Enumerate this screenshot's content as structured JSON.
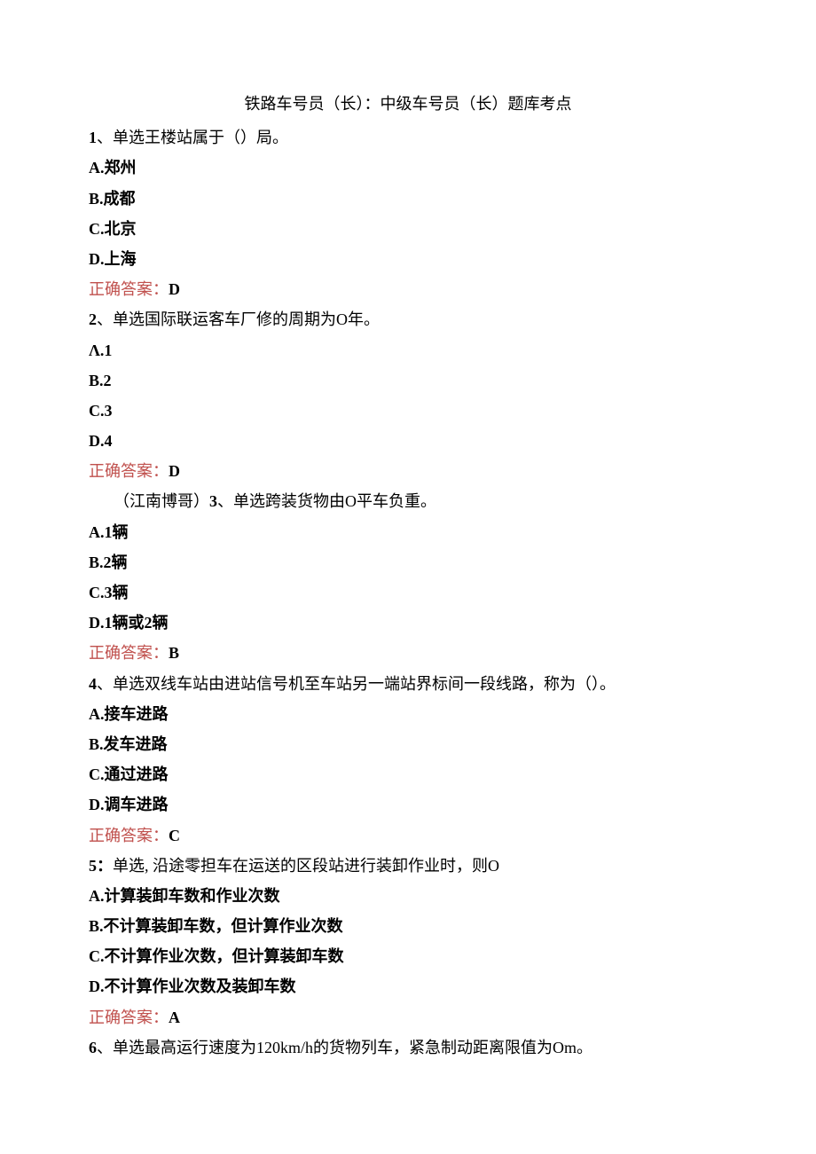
{
  "title": "铁路车号员（长）：中级车号员（长）题库考点",
  "q1": {
    "prefix": "1",
    "stem": "、单选王楼站属于（）局。",
    "A": "A.郑州",
    "B": "B.成都",
    "C": "C.北京",
    "D": "D.上海",
    "ans_label": "正确答案：",
    "ans_value": "D"
  },
  "q2": {
    "prefix": "2",
    "stem": "、单选国际联运客车厂修的周期为O年。",
    "A": "Λ.1",
    "B": "B.2",
    "C": "C.3",
    "D": "D.4",
    "ans_label": "正确答案：",
    "ans_value": "D"
  },
  "q3": {
    "inline_prefix": "（江南博哥）",
    "prefix": "3",
    "stem": "、单选跨装货物由O平车负重。",
    "A": "A.1辆",
    "B": "B.2辆",
    "C": "C.3辆",
    "D": "D.1辆或2辆",
    "ans_label": "正确答案：",
    "ans_value": "B"
  },
  "q4": {
    "prefix": "4",
    "stem": "、单选双线车站由进站信号机至车站另一端站界标间一段线路，称为（）。",
    "A": "A.接车进路",
    "B": "B.发车进路",
    "C": "C.通过进路",
    "D": "D.调车进路",
    "ans_label": "正确答案：",
    "ans_value": "C"
  },
  "q5": {
    "prefix": "5：",
    "stem": "单选, 沿途零担车在运送的区段站进行装卸作业时，则O",
    "A": "A.计算装卸车数和作业次数",
    "B": "B.不计算装卸车数，但计算作业次数",
    "C": "C.不计算作业次数，但计算装卸车数",
    "D": "D.不计算作业次数及装卸车数",
    "ans_label": "正确答案：",
    "ans_value": "A"
  },
  "q6": {
    "prefix": "6",
    "stem": "、单选最高运行速度为120km/h的货物列车，紧急制动距离限值为Om。"
  }
}
